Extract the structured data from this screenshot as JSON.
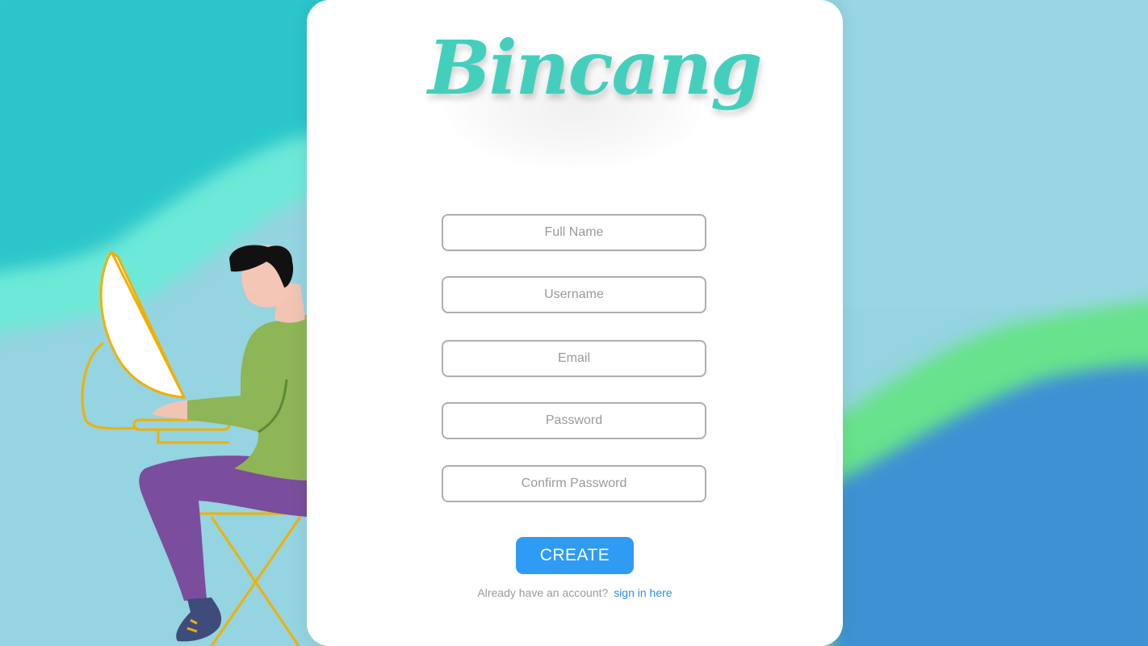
{
  "app": {
    "logo_text": "Bincang"
  },
  "form": {
    "fields": [
      {
        "placeholder": "Full Name",
        "value": ""
      },
      {
        "placeholder": "Username",
        "value": ""
      },
      {
        "placeholder": "Email",
        "value": ""
      },
      {
        "placeholder": "Password",
        "value": ""
      },
      {
        "placeholder": "Confirm Password",
        "value": ""
      }
    ],
    "submit_label": "CREATE",
    "signin_prompt": "Already have an account?",
    "signin_link": "sign in here"
  },
  "colors": {
    "brand": "#44cfbd",
    "button": "#2e9bf5",
    "link": "#2e8de6",
    "field_border": "#aeaeae"
  }
}
